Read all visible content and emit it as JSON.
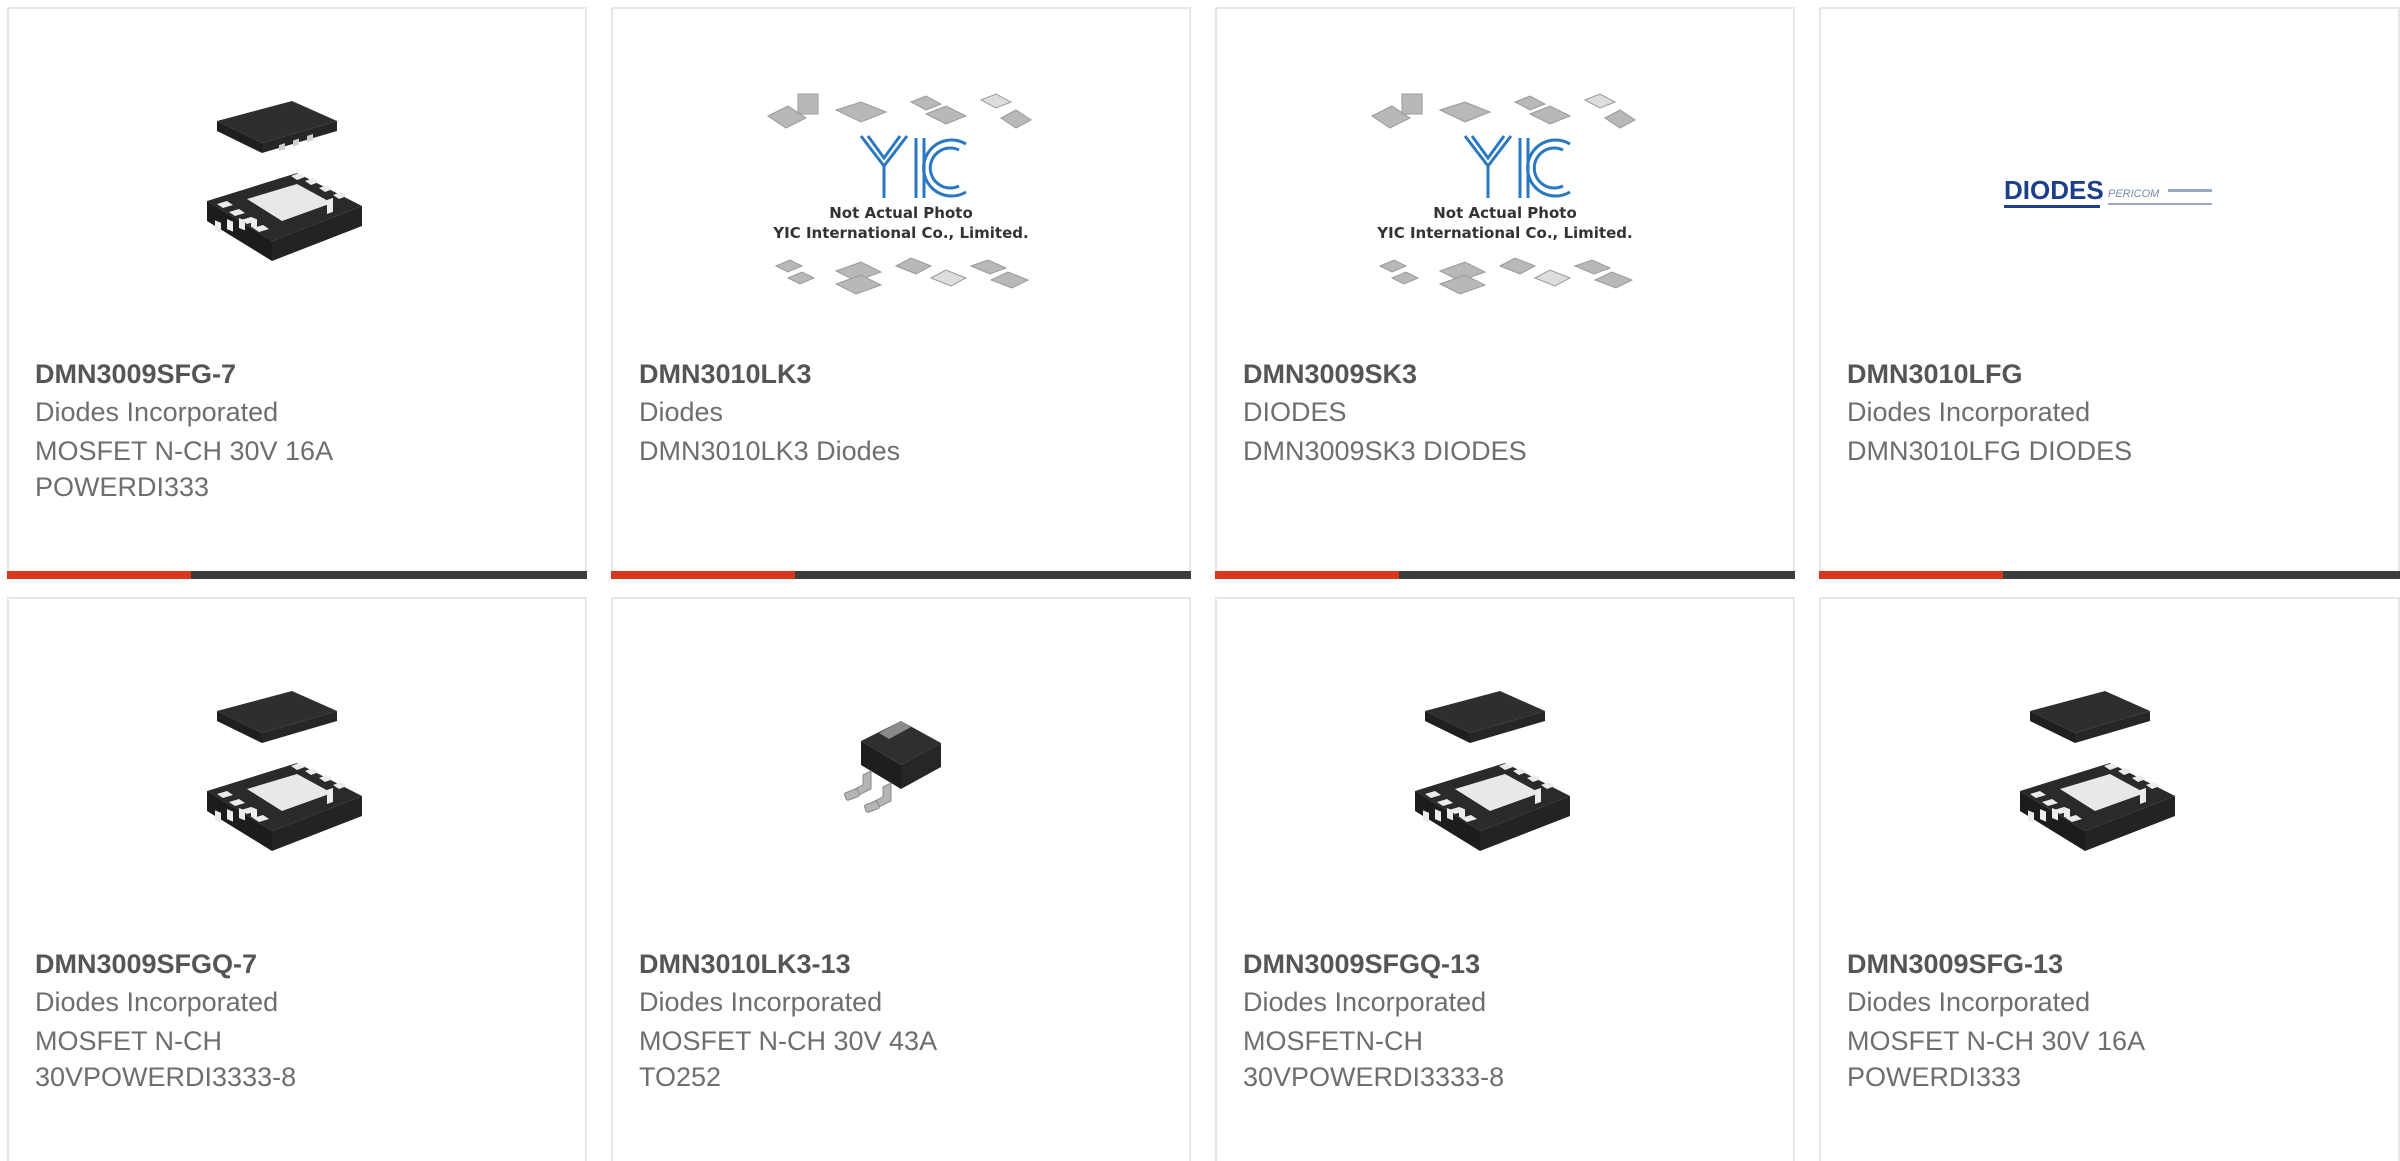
{
  "colors": {
    "accent": "#d9381e",
    "bar": "#3c3c3c",
    "border": "#e6e6e6",
    "title": "#555555",
    "text": "#6e6e6e"
  },
  "placeholder_image": {
    "line1": "Not Actual Photo",
    "line2": "YIC International Co., Limited.",
    "logo": "YIC"
  },
  "diodes_logo": {
    "brand": "DIODES",
    "sub": "PERICOM"
  },
  "products": [
    {
      "part_number": "DMN3009SFG-7",
      "manufacturer": "Diodes Incorporated",
      "description": "MOSFET N-CH 30V 16A POWERDI333",
      "image": "qfn-package-icon"
    },
    {
      "part_number": "DMN3010LK3",
      "manufacturer": "Diodes",
      "description": "DMN3010LK3 Diodes",
      "image": "not-actual-photo-placeholder"
    },
    {
      "part_number": "DMN3009SK3",
      "manufacturer": "DIODES",
      "description": "DMN3009SK3 DIODES",
      "image": "not-actual-photo-placeholder"
    },
    {
      "part_number": "DMN3010LFG",
      "manufacturer": "Diodes Incorporated",
      "description": "DMN3010LFG DIODES",
      "image": "diodes-logo"
    },
    {
      "part_number": "DMN3009SFGQ-7",
      "manufacturer": "Diodes Incorporated",
      "description": "MOSFET N-CH 30VPOWERDI3333-8",
      "image": "qfn-package-icon"
    },
    {
      "part_number": "DMN3010LK3-13",
      "manufacturer": "Diodes Incorporated",
      "description": "MOSFET N-CH 30V 43A TO252",
      "image": "to252-package-icon"
    },
    {
      "part_number": "DMN3009SFGQ-13",
      "manufacturer": "Diodes Incorporated",
      "description": "MOSFETN-CH 30VPOWERDI3333-8",
      "image": "qfn-package-icon"
    },
    {
      "part_number": "DMN3009SFG-13",
      "manufacturer": "Diodes Incorporated",
      "description": "MOSFET N-CH 30V 16A POWERDI333",
      "image": "qfn-package-icon"
    }
  ]
}
